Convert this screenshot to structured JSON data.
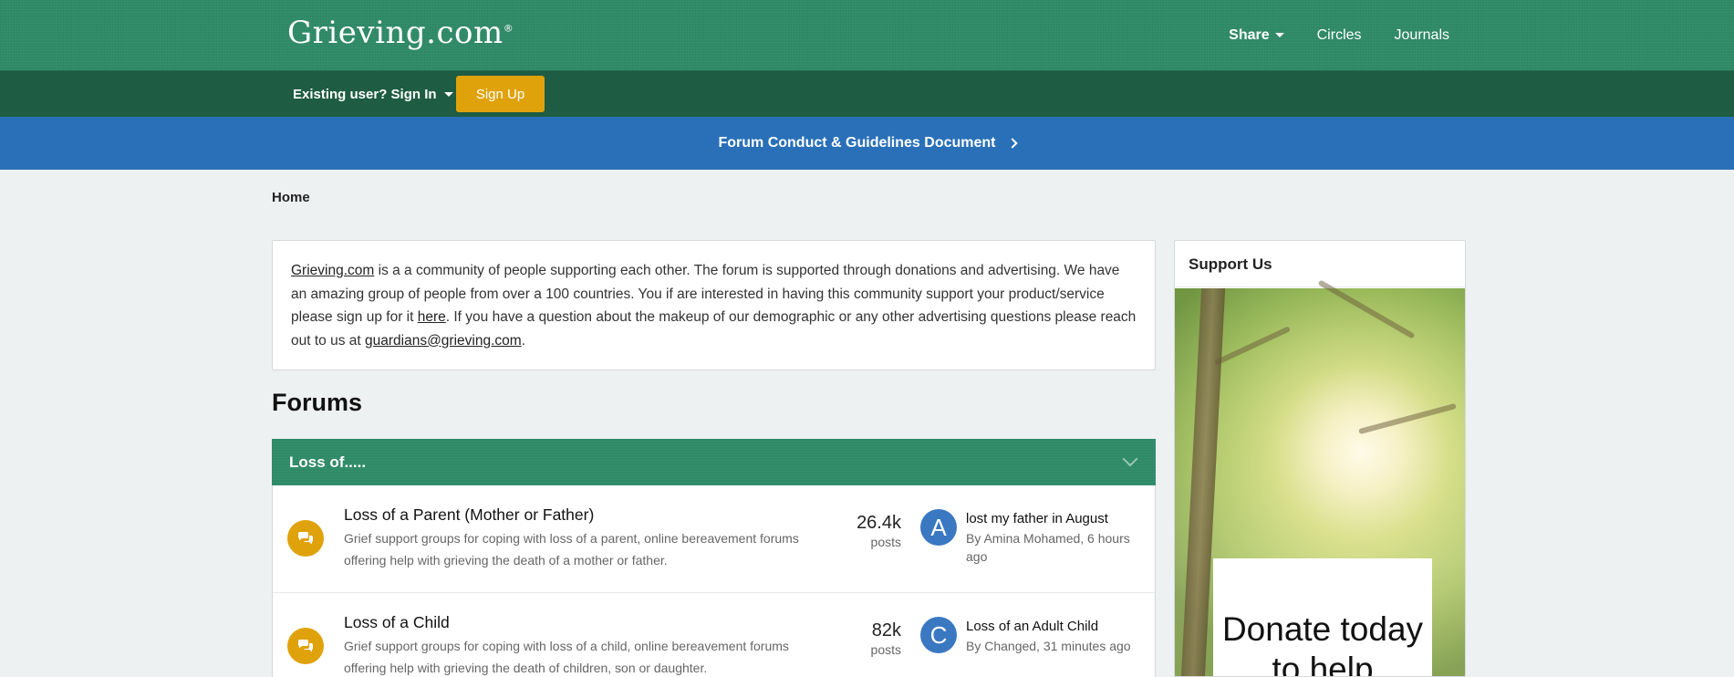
{
  "header": {
    "logo": "Grieving.com",
    "logo_mark": "®",
    "nav": [
      {
        "label": "Share"
      },
      {
        "label": "Circles"
      },
      {
        "label": "Journals"
      }
    ]
  },
  "subbar": {
    "signin_label": "Existing user? Sign In",
    "signup_label": "Sign Up"
  },
  "announcement": {
    "label": "Forum Conduct & Guidelines Document"
  },
  "breadcrumb": {
    "home": "Home"
  },
  "intro": {
    "site_link": "Grieving.com",
    "text1": " is a a community of people supporting each other. The forum is supported through donations and advertising. We have an amazing group of people from over a 100 countries. You if are interested in having this community support your product/service please sign up for it ",
    "here_link": "here",
    "text2": ". If you have a question about the makeup of our demographic or any other advertising questions please reach out to us at ",
    "email_link": "guardians@grieving.com",
    "text3": "."
  },
  "forums": {
    "title": "Forums",
    "category": "Loss of.....",
    "rows": [
      {
        "title": "Loss of a Parent (Mother or Father)",
        "description": "Grief support groups for coping with loss of a parent, online bereavement forums offering help with grieving the death of a mother or father.",
        "count": "26.4k",
        "count_label": "posts",
        "avatar_letter": "A",
        "last_title": "lost my father in August",
        "last_meta": "By Amina Mohamed, 6 hours ago"
      },
      {
        "title": "Loss of a Child",
        "description": "Grief support groups for coping with loss of a child, online bereavement forums offering help with grieving the death of children, son or daughter.",
        "count": "82k",
        "count_label": "posts",
        "avatar_letter": "C",
        "last_title": "Loss of an Adult Child",
        "last_meta": "By Changed, 31 minutes ago"
      }
    ]
  },
  "sidebar": {
    "title": "Support Us",
    "donate_text": "Donate today to help"
  },
  "colors": {
    "header_green": "#2f8a68",
    "subbar_green": "#1e5c43",
    "announce_blue": "#2a70b8",
    "accent_gold": "#e0a20b",
    "avatar_blue": "#3a78c2"
  }
}
